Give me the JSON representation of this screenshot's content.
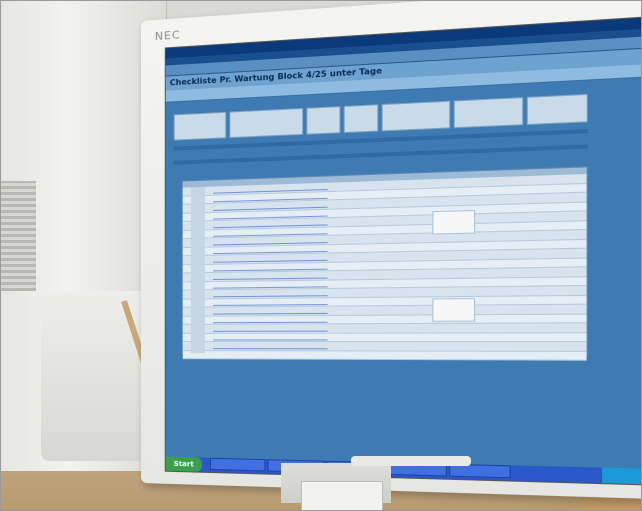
{
  "photo": {
    "brand_text": "NEC",
    "screen_app_title": "Checkliste Pr. Wartung Block 4/25 unter Tage",
    "taskbar_start": "Start"
  }
}
